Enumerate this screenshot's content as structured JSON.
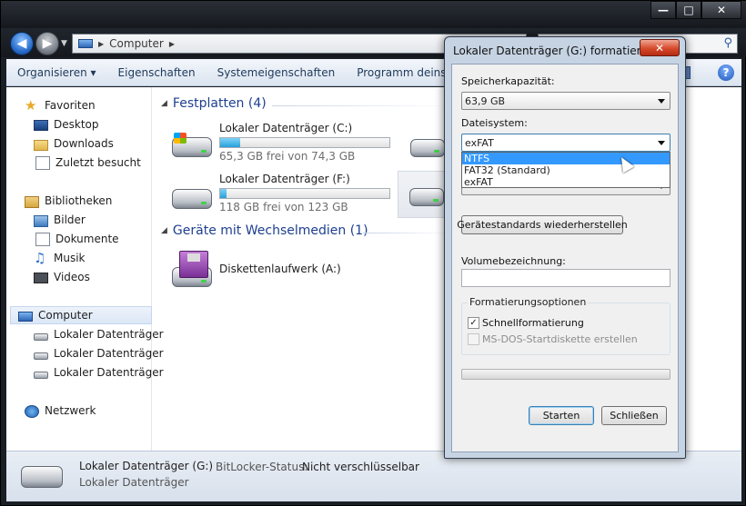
{
  "explorer": {
    "address": {
      "segments": [
        "Computer"
      ]
    },
    "toolbar": [
      "Organisieren ▾",
      "Eigenschaften",
      "Systemeigenschaften",
      "Programm deinstall"
    ],
    "help": "?",
    "sidebar": {
      "favorites": {
        "title": "Favoriten",
        "items": [
          "Desktop",
          "Downloads",
          "Zuletzt besucht"
        ]
      },
      "libraries": {
        "title": "Bibliotheken",
        "items": [
          "Bilder",
          "Dokumente",
          "Musik",
          "Videos"
        ]
      },
      "computer": {
        "title": "Computer",
        "items": [
          "Lokaler Datenträger",
          "Lokaler Datenträger",
          "Lokaler Datenträger"
        ]
      },
      "network": {
        "title": "Netzwerk"
      }
    },
    "groups": {
      "hdd": {
        "title": "Festplatten (4)"
      },
      "removable": {
        "title": "Geräte mit Wechselmedien (1)"
      }
    },
    "drives": [
      {
        "name": "Lokaler Datenträger (C:)",
        "free": "65,3 GB frei von 74,3 GB",
        "used_fraction": 0.12
      },
      {
        "name": "Lokaler Datenträger (F:)",
        "free": "118 GB frei von 123 GB",
        "used_fraction": 0.04
      }
    ],
    "floppy": {
      "name": "Diskettenlaufwerk (A:)"
    },
    "status": {
      "name": "Lokaler Datenträger (G:)",
      "type": "Lokaler Datenträger",
      "bitlocker_key": "BitLocker-Status:",
      "bitlocker_value": "Nicht verschlüsselbar"
    },
    "window_buttons": {
      "min": "—",
      "max": "□",
      "close": "✕"
    }
  },
  "dialog": {
    "title": "Lokaler Datenträger (G:) formatieren",
    "close": "✕",
    "capacity_label": "Speicherkapazität:",
    "capacity_value": "63,9 GB",
    "filesystem_label": "Dateisystem:",
    "filesystem_value": "exFAT",
    "filesystem_options": [
      "NTFS",
      "FAT32 (Standard)",
      "exFAT"
    ],
    "filesystem_highlighted": "NTFS",
    "restore_button": "Gerätestandards wiederherstellen",
    "volume_label": "Volumebezeichnung:",
    "volume_value": "",
    "options_title": "Formatierungsoptionen",
    "quick_format": {
      "label": "Schnellformatierung",
      "checked": true
    },
    "msdos": {
      "label": "MS-DOS-Startdiskette erstellen",
      "checked": false,
      "disabled": true
    },
    "progress": 0,
    "start_button": "Starten",
    "close_button": "Schließen"
  }
}
